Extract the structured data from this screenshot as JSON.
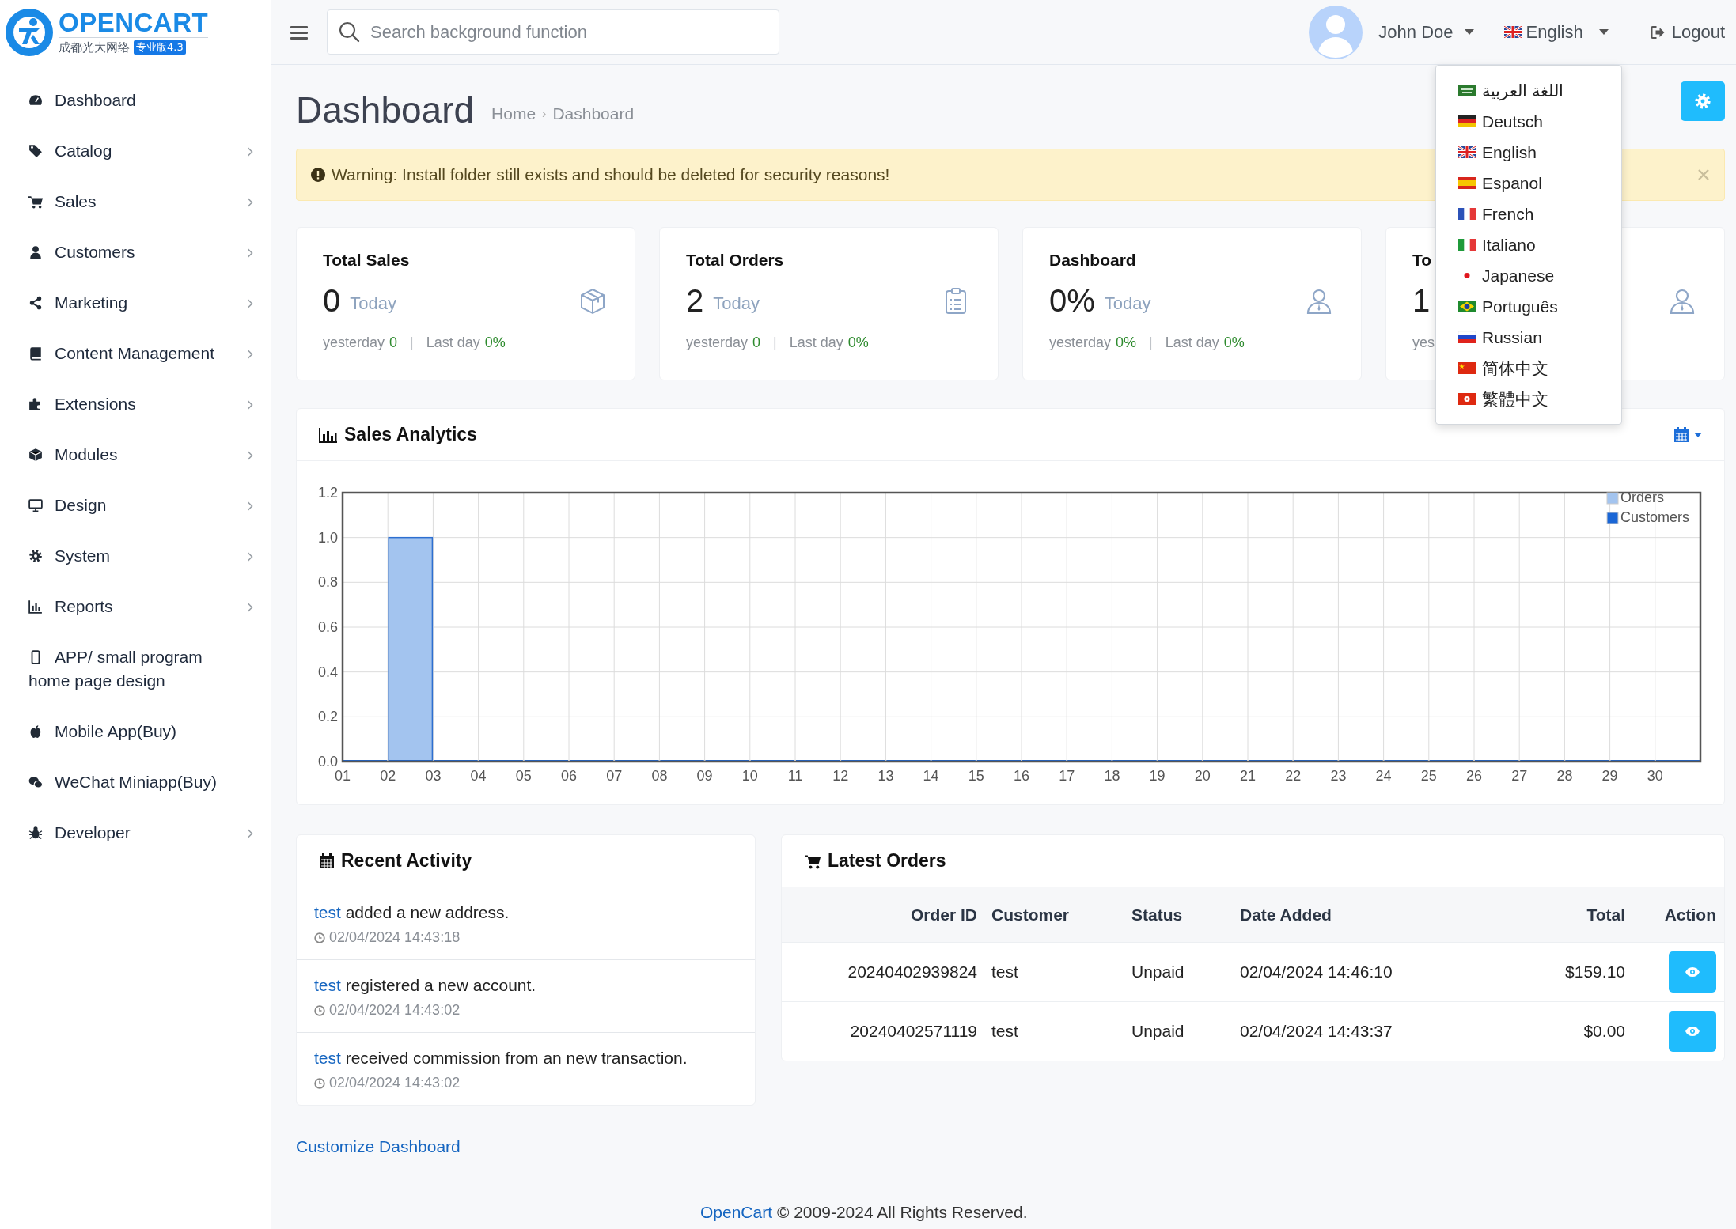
{
  "logo": {
    "title": "OPENCART",
    "subtitle": "成都光大网络",
    "badge": "专业版4.3"
  },
  "sidebar": {
    "items": [
      {
        "label": "Dashboard",
        "expandable": false
      },
      {
        "label": "Catalog",
        "expandable": true
      },
      {
        "label": "Sales",
        "expandable": true
      },
      {
        "label": "Customers",
        "expandable": true
      },
      {
        "label": "Marketing",
        "expandable": true
      },
      {
        "label": "Content Management",
        "expandable": true
      },
      {
        "label": "Extensions",
        "expandable": true
      },
      {
        "label": "Modules",
        "expandable": true
      },
      {
        "label": "Design",
        "expandable": true
      },
      {
        "label": "System",
        "expandable": true
      },
      {
        "label": "Reports",
        "expandable": true
      },
      {
        "label": "APP/ small program home page design",
        "expandable": false
      },
      {
        "label": "Mobile App(Buy)",
        "expandable": false
      },
      {
        "label": "WeChat Miniapp(Buy)",
        "expandable": false
      },
      {
        "label": "Developer",
        "expandable": true
      }
    ]
  },
  "header": {
    "search": {
      "placeholder": "Search background function"
    },
    "user": "John Doe",
    "language": "English",
    "logout": "Logout"
  },
  "language_menu": {
    "items": [
      {
        "label": "اللغة العربية"
      },
      {
        "label": "Deutsch"
      },
      {
        "label": "English"
      },
      {
        "label": "Espanol"
      },
      {
        "label": "French"
      },
      {
        "label": "Italiano"
      },
      {
        "label": "Japanese"
      },
      {
        "label": "Português"
      },
      {
        "label": "Russian"
      },
      {
        "label": "简体中文"
      },
      {
        "label": "繁體中文"
      }
    ]
  },
  "page": {
    "title": "Dashboard",
    "breadcrumbs": [
      "Home",
      "Dashboard"
    ],
    "breadcrumb_separator": "›"
  },
  "alert": {
    "text": "Warning: Install folder still exists and should be deleted for security reasons!"
  },
  "cards": [
    {
      "title": "Total Sales",
      "value": "0",
      "period": "Today",
      "footer": [
        {
          "kind": "label",
          "text": "yesterday"
        },
        {
          "kind": "value",
          "text": "0"
        },
        {
          "kind": "separator",
          "text": "|"
        },
        {
          "kind": "label",
          "text": "Last day"
        },
        {
          "kind": "value",
          "text": "0%"
        }
      ]
    },
    {
      "title": "Total Orders",
      "value": "2",
      "period": "Today",
      "footer": [
        {
          "kind": "label",
          "text": "yesterday"
        },
        {
          "kind": "value",
          "text": "0"
        },
        {
          "kind": "separator",
          "text": "|"
        },
        {
          "kind": "label",
          "text": "Last day"
        },
        {
          "kind": "value",
          "text": "0%"
        }
      ]
    },
    {
      "title": "Dashboard",
      "value": "0%",
      "period": "Today",
      "footer": [
        {
          "kind": "label",
          "text": "yesterday"
        },
        {
          "kind": "value",
          "text": "0%"
        },
        {
          "kind": "separator",
          "text": "|"
        },
        {
          "kind": "label",
          "text": "Last day"
        },
        {
          "kind": "value",
          "text": "0%"
        }
      ]
    },
    {
      "title": "To",
      "value": "1",
      "footer": [
        {
          "kind": "label",
          "text": "yes"
        }
      ]
    }
  ],
  "sales_analytics": {
    "title": "Sales Analytics",
    "chart_data": {
      "type": "bar",
      "categories": [
        "01",
        "02",
        "03",
        "04",
        "05",
        "06",
        "07",
        "08",
        "09",
        "10",
        "11",
        "12",
        "13",
        "14",
        "15",
        "16",
        "17",
        "18",
        "19",
        "20",
        "21",
        "22",
        "23",
        "24",
        "25",
        "26",
        "27",
        "28",
        "29",
        "30"
      ],
      "series": [
        {
          "name": "Orders",
          "color": "#a3c4ef",
          "values": [
            0,
            1,
            0,
            0,
            0,
            0,
            0,
            0,
            0,
            0,
            0,
            0,
            0,
            0,
            0,
            0,
            0,
            0,
            0,
            0,
            0,
            0,
            0,
            0,
            0,
            0,
            0,
            0,
            0,
            0
          ]
        },
        {
          "name": "Customers",
          "color": "#1a66d6",
          "values": [
            0,
            0,
            0,
            0,
            0,
            0,
            0,
            0,
            0,
            0,
            0,
            0,
            0,
            0,
            0,
            0,
            0,
            0,
            0,
            0,
            0,
            0,
            0,
            0,
            0,
            0,
            0,
            0,
            0,
            0
          ]
        }
      ],
      "grid": true,
      "legend": true,
      "ylim": [
        0,
        1.2
      ],
      "yticks": [
        {
          "value": 0,
          "label": "0.0"
        },
        {
          "value": 0.2,
          "label": "0.2"
        },
        {
          "value": 0.4,
          "label": "0.4"
        },
        {
          "value": 0.6,
          "label": "0.6"
        },
        {
          "value": 0.8,
          "label": "0.8"
        },
        {
          "value": 1,
          "label": "1.0"
        },
        {
          "value": 1.2,
          "label": "1.2"
        }
      ]
    }
  },
  "recent_activity": {
    "title": "Recent Activity",
    "items": [
      {
        "user": "test",
        "text": "added a new address.",
        "time": "02/04/2024 14:43:18"
      },
      {
        "user": "test",
        "text": "registered a new account.",
        "time": "02/04/2024 14:43:02"
      },
      {
        "user": "test",
        "text": "received commission from an new transaction.",
        "time": "02/04/2024 14:43:02"
      }
    ]
  },
  "latest_orders": {
    "title": "Latest Orders",
    "columns": [
      "Order ID",
      "Customer",
      "Status",
      "Date Added",
      "Total",
      "Action"
    ],
    "rows": [
      [
        "20240402939824",
        "test",
        "Unpaid",
        "02/04/2024 14:46:10",
        "$159.10"
      ],
      [
        "20240402571119",
        "test",
        "Unpaid",
        "02/04/2024 14:43:37",
        "$0.00"
      ]
    ]
  },
  "customize_link": "Customize Dashboard",
  "footer": {
    "link": "OpenCart",
    "text": "© 2009-2024 All Rights Reserved."
  }
}
